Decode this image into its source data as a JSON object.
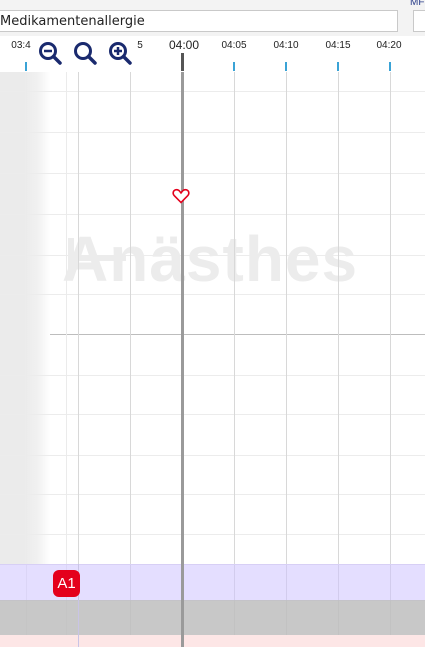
{
  "header": {
    "allergy_field_value": "Medikamentenallergie",
    "right_label": "MF"
  },
  "timeline": {
    "labels": [
      "03:4",
      "5",
      "04:00",
      "04:05",
      "04:10",
      "04:15",
      "04:20"
    ],
    "current_time": "04:00"
  },
  "zoom": {
    "icons": [
      "zoom-out-icon",
      "zoom-reset-icon",
      "zoom-in-icon"
    ]
  },
  "chart": {
    "watermark": "Anästhes",
    "marker_icon": "heart-icon"
  },
  "bands": {
    "badge_label": "A1"
  },
  "colors": {
    "badge": "#e4001c",
    "tick": "#3aa3d6",
    "heart": "#e4001c",
    "zoom_icon": "#1a2a6e",
    "purple_band": "#e1dbff",
    "gray_band": "#c4c4c4",
    "pink_band": "#fde6e6"
  }
}
